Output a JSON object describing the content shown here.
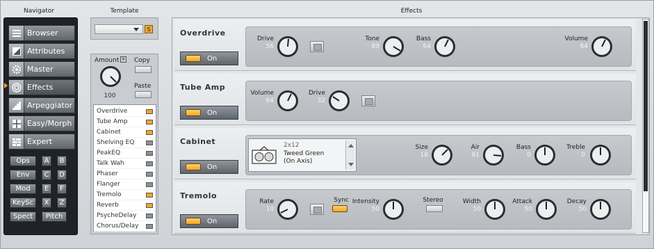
{
  "titles": {
    "navigator": "Navigator",
    "template": "Template",
    "effects": "Effects"
  },
  "navigator": {
    "items": [
      {
        "label": "Browser",
        "icon": "browser-icon"
      },
      {
        "label": "Attributes",
        "icon": "attributes-icon"
      },
      {
        "label": "Master",
        "icon": "gear-icon"
      },
      {
        "label": "Effects",
        "icon": "effects-icon",
        "active": true
      },
      {
        "label": "Arpeggiator",
        "icon": "stairs-icon"
      },
      {
        "label": "Easy/Morph",
        "icon": "grid-icon"
      },
      {
        "label": "Expert",
        "icon": "expert-icon"
      }
    ],
    "small_buttons": [
      "Ops",
      "A",
      "B",
      "Env",
      "C",
      "D",
      "Mod",
      "E",
      "F",
      "KeySc",
      "X",
      "Z",
      "Spect",
      "Pitch"
    ]
  },
  "template": {
    "dropdown_value": "",
    "s_label": "S"
  },
  "panel": {
    "amount_label": "Amount",
    "amount_value": "100",
    "copy_label": "Copy",
    "paste_label": "Paste",
    "effects_list": [
      {
        "name": "Overdrive",
        "on": true
      },
      {
        "name": "Tube Amp",
        "on": true
      },
      {
        "name": "Cabinet",
        "on": true
      },
      {
        "name": "Shelving EQ",
        "on": false
      },
      {
        "name": "PeakEQ",
        "on": false
      },
      {
        "name": "Talk Wah",
        "on": false
      },
      {
        "name": "Phaser",
        "on": false
      },
      {
        "name": "Flanger",
        "on": false
      },
      {
        "name": "Tremolo",
        "on": true
      },
      {
        "name": "Reverb",
        "on": true
      },
      {
        "name": "PsycheDelay",
        "on": false
      },
      {
        "name": "Chorus/Delay",
        "on": false
      }
    ]
  },
  "effects": {
    "on_label": "On",
    "overdrive": {
      "name": "Overdrive",
      "drive": {
        "label": "Drive",
        "value": "56"
      },
      "tone": {
        "label": "Tone",
        "value": "89"
      },
      "bass": {
        "label": "Bass",
        "value": "64"
      },
      "volume": {
        "label": "Volume",
        "value": "64"
      }
    },
    "tube_amp": {
      "name": "Tube Amp",
      "volume": {
        "label": "Volume",
        "value": "64"
      },
      "drive": {
        "label": "Drive",
        "value": "32"
      }
    },
    "cabinet": {
      "name": "Cabinet",
      "cab_size": "2x12",
      "cab_name": "Tweed Green",
      "cab_mic": "(On Axis)",
      "size": {
        "label": "Size",
        "value": "18"
      },
      "air": {
        "label": "Air",
        "value": "81"
      },
      "bass": {
        "label": "Bass",
        "value": "0"
      },
      "treble": {
        "label": "Treble",
        "value": "0"
      }
    },
    "tremolo": {
      "name": "Tremolo",
      "rate": {
        "label": "Rate",
        "value": "10"
      },
      "sync_label": "Sync",
      "intensity": {
        "label": "Intensity",
        "value": "50"
      },
      "stereo_label": "Stereo",
      "width": {
        "label": "Width",
        "value": "50"
      },
      "attack": {
        "label": "Attack",
        "value": "50"
      },
      "decay": {
        "label": "Decay",
        "value": "50"
      }
    }
  },
  "colors": {
    "accent": "#f2a42a",
    "nav_bg": "#1f2226",
    "panel_bg": "#c9ccd0"
  }
}
